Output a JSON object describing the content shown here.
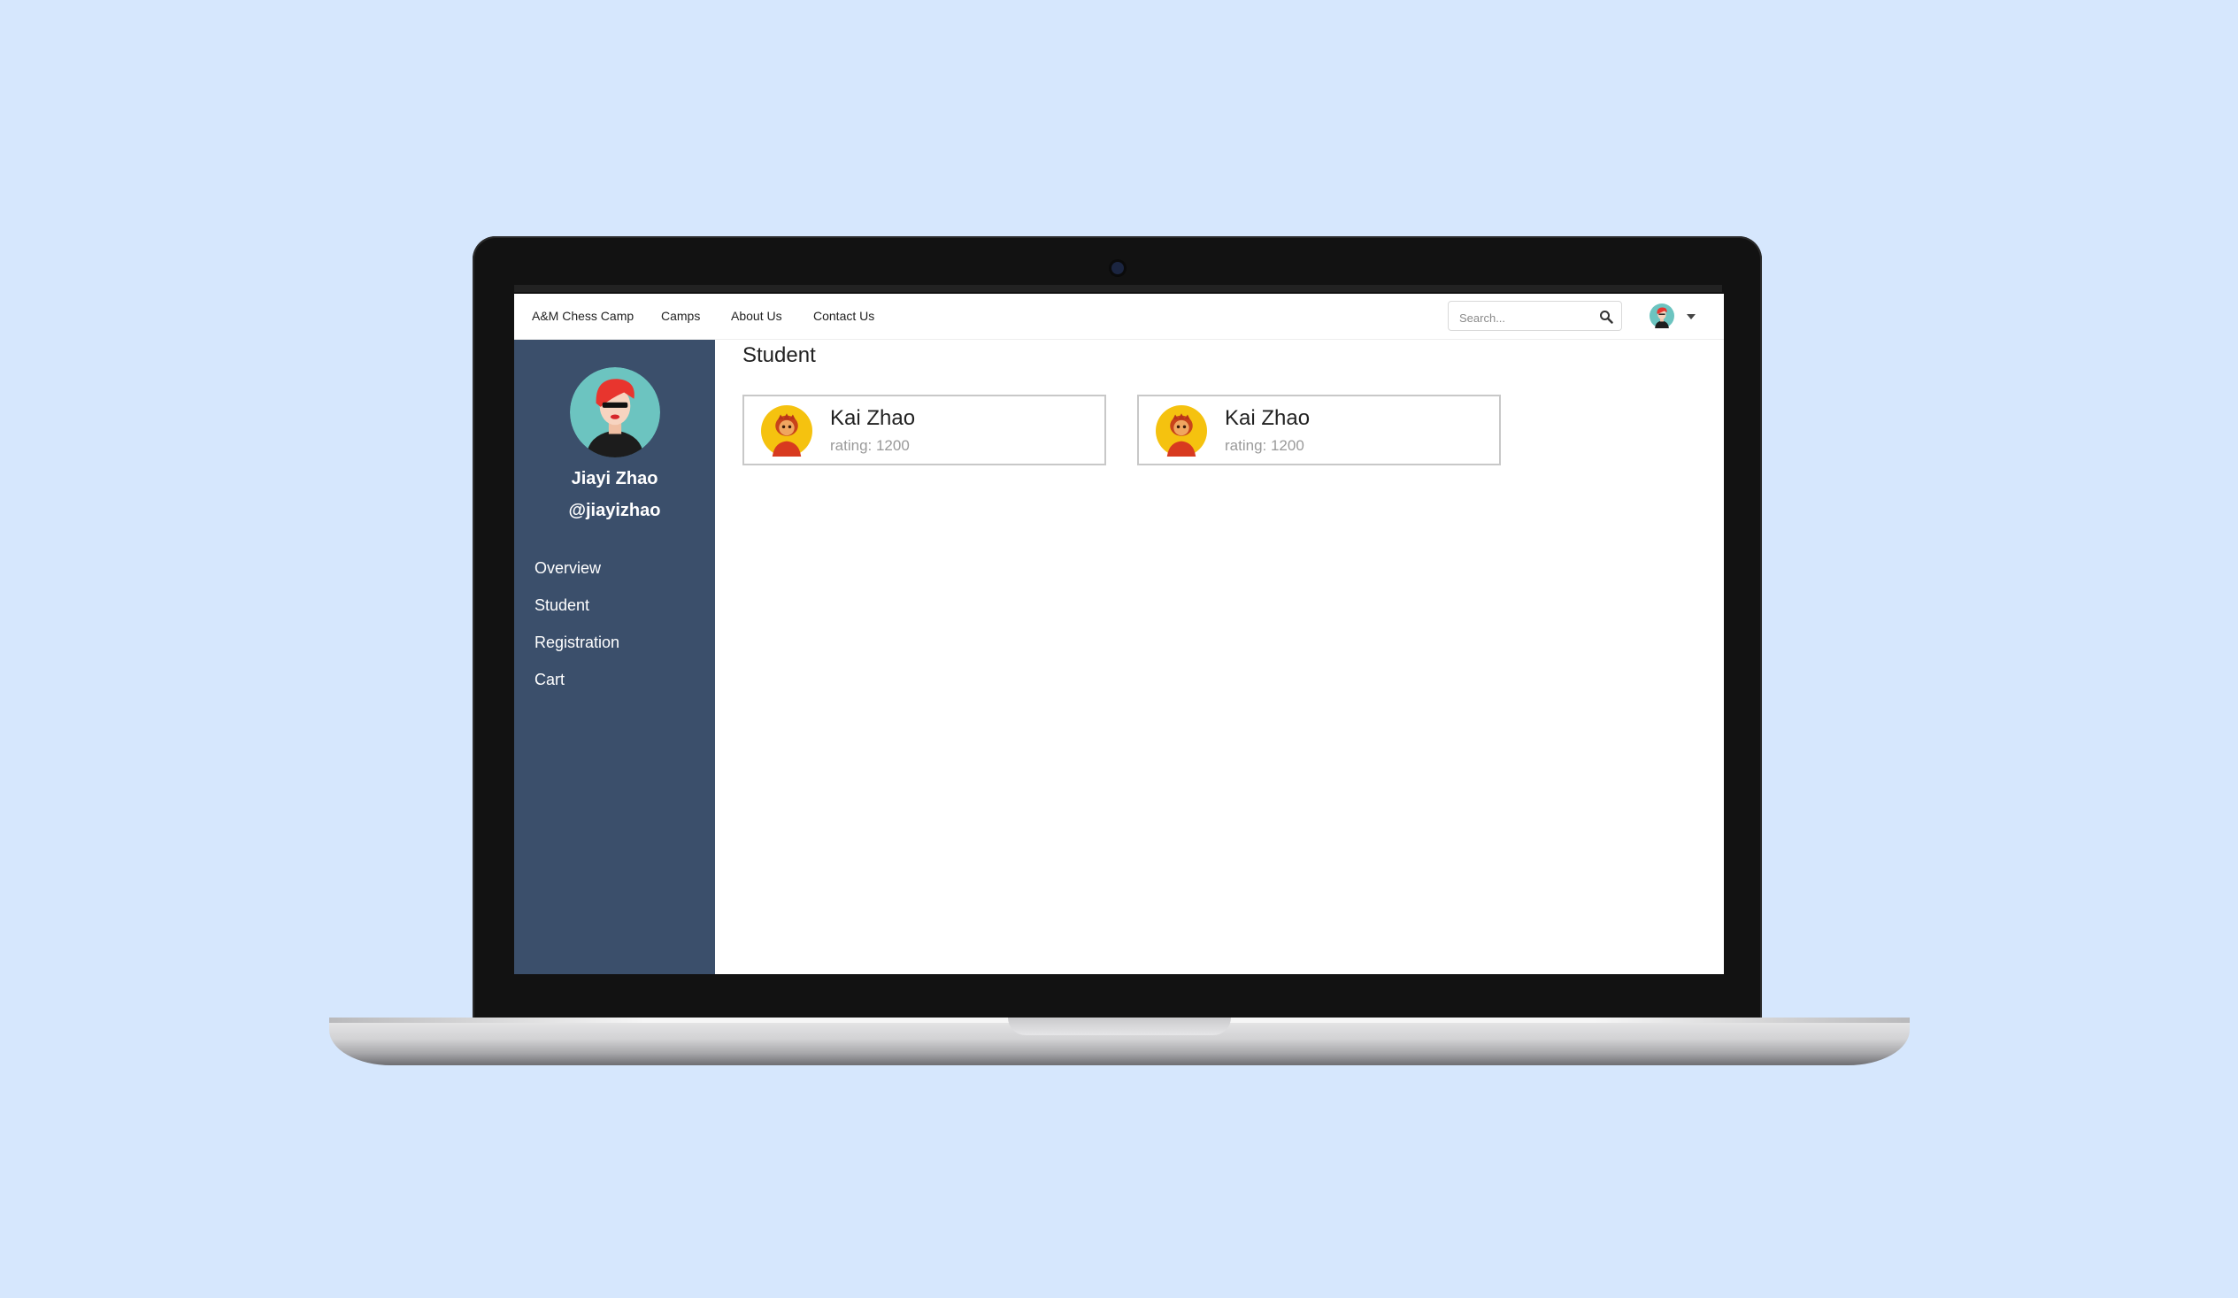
{
  "nav": {
    "brand": "A&M Chess Camp",
    "links": [
      "Camps",
      "About Us",
      "Contact Us"
    ],
    "search_placeholder": "Search..."
  },
  "profile": {
    "name": "Jiayi Zhao",
    "handle": "@jiayizhao"
  },
  "sidebar": {
    "items": [
      {
        "label": "Overview"
      },
      {
        "label": "Student"
      },
      {
        "label": "Registration"
      },
      {
        "label": "Cart"
      }
    ]
  },
  "main": {
    "title": "Student",
    "students": [
      {
        "name": "Kai Zhao",
        "rating": "rating: 1200"
      },
      {
        "name": "Kai Zhao",
        "rating": "rating: 1200"
      }
    ]
  },
  "colors": {
    "page_background": "#d6e7fd",
    "sidebar": "#3b4f6b",
    "avatar_teal": "#6cc4c0",
    "student_avatar_yellow": "#f5c20f"
  },
  "icons": [
    "search-icon",
    "user-avatar-icon",
    "chevron-down-icon"
  ]
}
